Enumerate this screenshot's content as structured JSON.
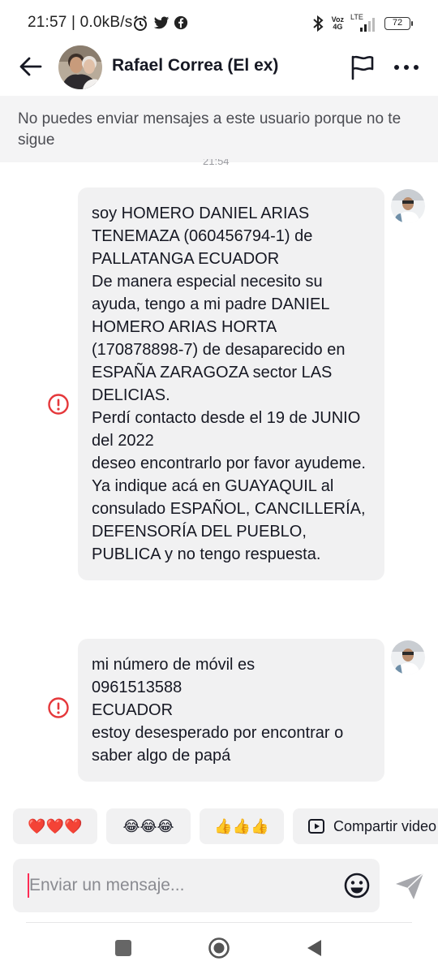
{
  "status_bar": {
    "time": "21:57",
    "speed": "0.0kB/s",
    "network_top": "Voz",
    "network_bottom": "4G",
    "lte_label": "LTE",
    "battery": "72"
  },
  "header": {
    "title": "Rafael Correa (El ex)"
  },
  "notice": {
    "text": "No puedes enviar mensajes a este usuario porque no te sigue",
    "peek_time": "21:54"
  },
  "messages": [
    {
      "text": "soy HOMERO DANIEL ARIAS TENEMAZA (060456794-1) de PALLATANGA ECUADOR\nDe manera especial necesito su ayuda, tengo a mi padre DANIEL HOMERO ARIAS HORTA (170878898-7) de desaparecido en ESPAÑA ZARAGOZA sector LAS DELICIAS.\nPerdí contacto desde el 19 de JUNIO del 2022\ndeseo encontrarlo por favor ayudeme.\nYa indique acá en GUAYAQUIL al consulado ESPAÑOL, CANCILLERÍA, DEFENSORÍA DEL PUEBLO, PUBLICA y no tengo respuesta."
    },
    {
      "text": "mi número de móvil  es\n0961513588\nECUADOR\nestoy desesperado por encontrar o saber algo de papá"
    }
  ],
  "quick_replies": {
    "hearts": "❤️❤️❤️",
    "laugh": "😂😂😂",
    "thumbs": "👍👍👍",
    "share_label": "Compartir video"
  },
  "composer": {
    "placeholder": "Enviar un mensaje..."
  },
  "colors": {
    "accent": "#fe2c55",
    "error": "#e5383b",
    "bubble": "#f1f1f2"
  }
}
